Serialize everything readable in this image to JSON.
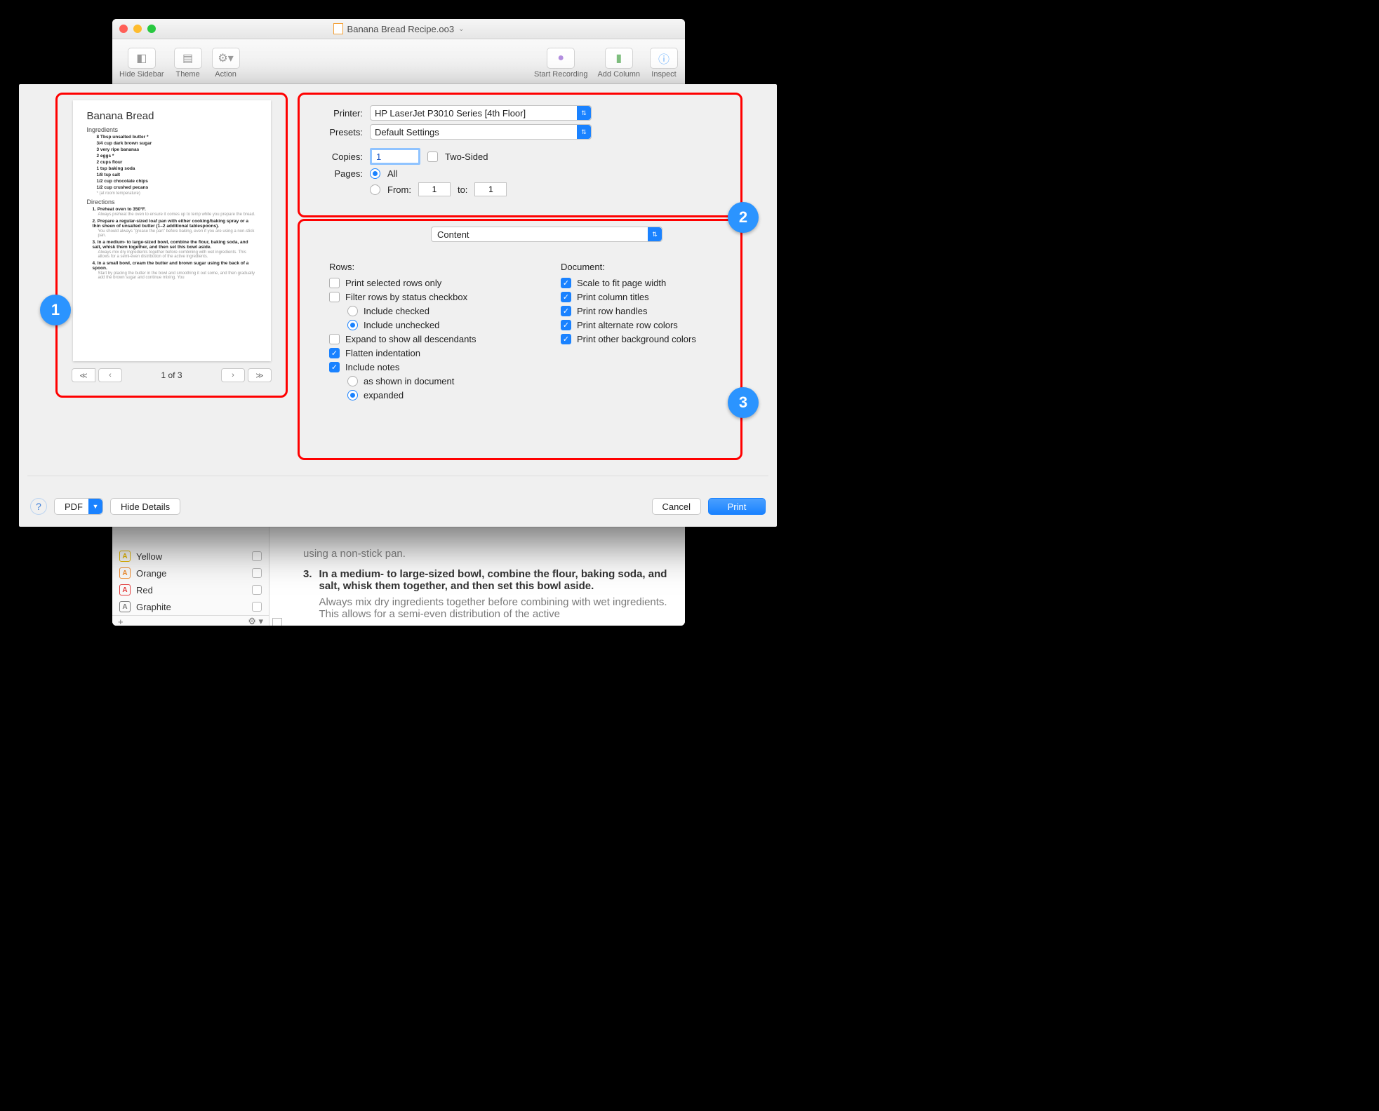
{
  "window": {
    "title": "Banana Bread Recipe.oo3",
    "chevron": "⌄"
  },
  "toolbar": {
    "hide_sidebar": "Hide Sidebar",
    "theme": "Theme",
    "action": "Action",
    "start_recording": "Start Recording",
    "add_column": "Add Column",
    "inspect": "Inspect"
  },
  "sidebar_colors": [
    {
      "letter": "A",
      "name": "Yellow",
      "border": "#e6b800",
      "color": "#e6b800"
    },
    {
      "letter": "A",
      "name": "Orange",
      "border": "#f08c2e",
      "color": "#f08c2e"
    },
    {
      "letter": "A",
      "name": "Red",
      "border": "#e23b3b",
      "color": "#e23b3b"
    },
    {
      "letter": "A",
      "name": "Graphite",
      "border": "#7a7a7a",
      "color": "#7a7a7a"
    }
  ],
  "sidebar_footer": {
    "plus": "+",
    "gear": "⚙ ▾"
  },
  "background_content": {
    "cut_line": "using a non-stick pan.",
    "num": "3.",
    "step_bold": "In a medium- to large-sized bowl, combine the flour, baking soda, and salt, whisk them together, and then set this bowl aside.",
    "step_note": "Always mix dry ingredients together before combining with wet ingredients. This allows for a semi-even distribution of the active"
  },
  "preview": {
    "title": "Banana Bread",
    "section_ing": "Ingredients",
    "ingredients": [
      "8 Tbsp unsalted butter *",
      "3/4 cup dark brown sugar",
      "3 very ripe bananas",
      "2 eggs *",
      "2 cups flour",
      "1 tsp baking soda",
      "1/8 tsp salt",
      "1/2 cup chocolate chips",
      "1/2 cup crushed pecans"
    ],
    "sub": "* (at room temperature)",
    "section_dir": "Directions",
    "dirs": [
      {
        "n": "1.",
        "b": "Preheat oven to 350°F.",
        "d": "Always preheat the oven to ensure it comes up to temp while you prepare the bread."
      },
      {
        "n": "2.",
        "b": "Prepare a regular-sized loaf pan with either cooking/baking spray or a thin sheen of unsalted butter (1–2 additional tablespoons).",
        "d": "You should always \"grease the pan\" before baking, even if you are using a non-stick pan."
      },
      {
        "n": "3.",
        "b": "In a medium- to large-sized bowl, combine the flour, baking soda, and salt, whisk them together, and then set this bowl aside.",
        "d": "Always mix dry ingredients together before combining with wet ingredients. This allows for a semi-even distribution of the active ingredients."
      },
      {
        "n": "4.",
        "b": "In a small bowl, cream the butter and brown sugar using the back of a spoon.",
        "d": "Start by placing the butter in the bowl and smoothing it out some, and then gradually add the brown sugar and continue mixing. You"
      }
    ],
    "page_label": "1 of 3",
    "nav": {
      "first": "≪",
      "prev": "‹",
      "next": "›",
      "last": "≫"
    }
  },
  "print": {
    "printer_label": "Printer:",
    "printer_value": "HP LaserJet P3010 Series [4th Floor]",
    "presets_label": "Presets:",
    "presets_value": "Default Settings",
    "copies_label": "Copies:",
    "copies_value": "1",
    "two_sided": "Two-Sided",
    "pages_label": "Pages:",
    "pages_all": "All",
    "pages_from": "From:",
    "pages_to": "to:",
    "from_val": "1",
    "to_val": "1"
  },
  "content": {
    "selector": "Content",
    "rows_header": "Rows:",
    "doc_header": "Document:",
    "rows": {
      "selected_only": "Print selected rows only",
      "filter": "Filter rows by status checkbox",
      "include_checked": "Include checked",
      "include_unchecked": "Include unchecked",
      "expand_desc": "Expand to show all descendants",
      "flatten": "Flatten indentation",
      "include_notes": "Include notes",
      "as_shown": "as shown in document",
      "expanded": "expanded"
    },
    "doc": {
      "scale": "Scale to fit page width",
      "col_titles": "Print column titles",
      "row_handles": "Print row handles",
      "alt_colors": "Print alternate row colors",
      "bg_colors": "Print other background colors"
    }
  },
  "buttons": {
    "help": "?",
    "pdf": "PDF",
    "hide": "Hide Details",
    "cancel": "Cancel",
    "print": "Print"
  },
  "badges": {
    "b1": "1",
    "b2": "2",
    "b3": "3"
  }
}
